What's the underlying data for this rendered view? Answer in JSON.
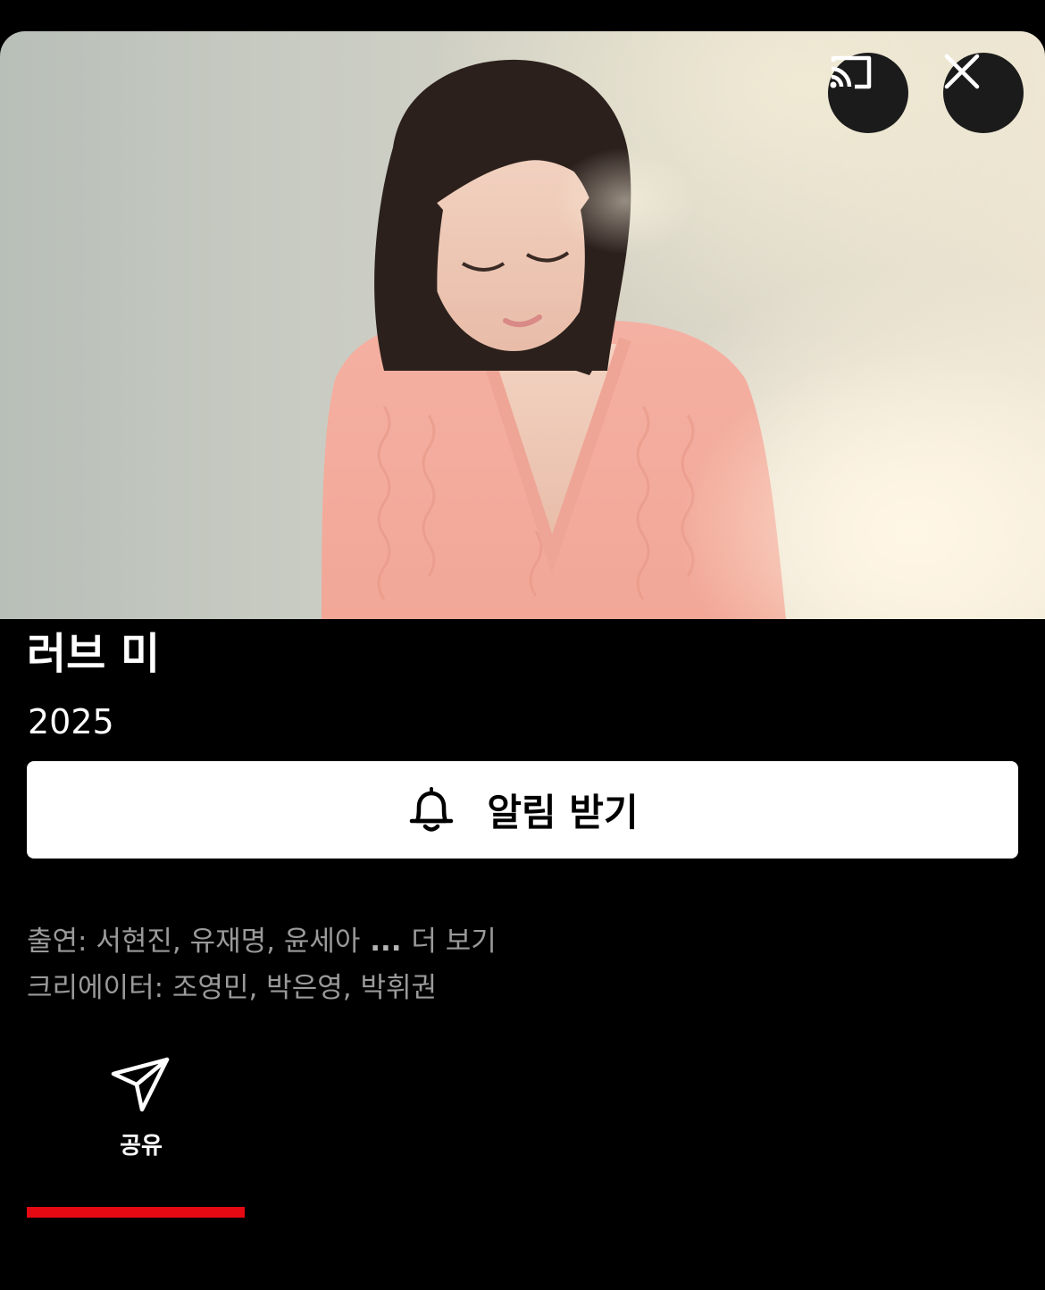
{
  "header": {
    "cast_icon": "cast-icon",
    "close_icon": "close-icon"
  },
  "hero": {
    "image_desc": "hero-artwork"
  },
  "title": "러브 미",
  "year": "2025",
  "remind_button": {
    "label": "알림 받기",
    "icon": "bell-icon"
  },
  "credits": {
    "cast_prefix": "출연: ",
    "cast_names": "서현진, 유재명, 윤세아",
    "ellipsis": " ... ",
    "more_label": "더 보기",
    "creator_prefix": "크리에이터: ",
    "creator_names": "조영민, 박은영, 박휘권"
  },
  "actions": {
    "share_label": "공유",
    "share_icon": "send-icon"
  },
  "tabs": {
    "active_indicator_color": "#e50914"
  },
  "colors": {
    "background": "#000000",
    "accent": "#e50914",
    "button_bg": "#ffffff",
    "muted_text": "#9a9a9a"
  }
}
